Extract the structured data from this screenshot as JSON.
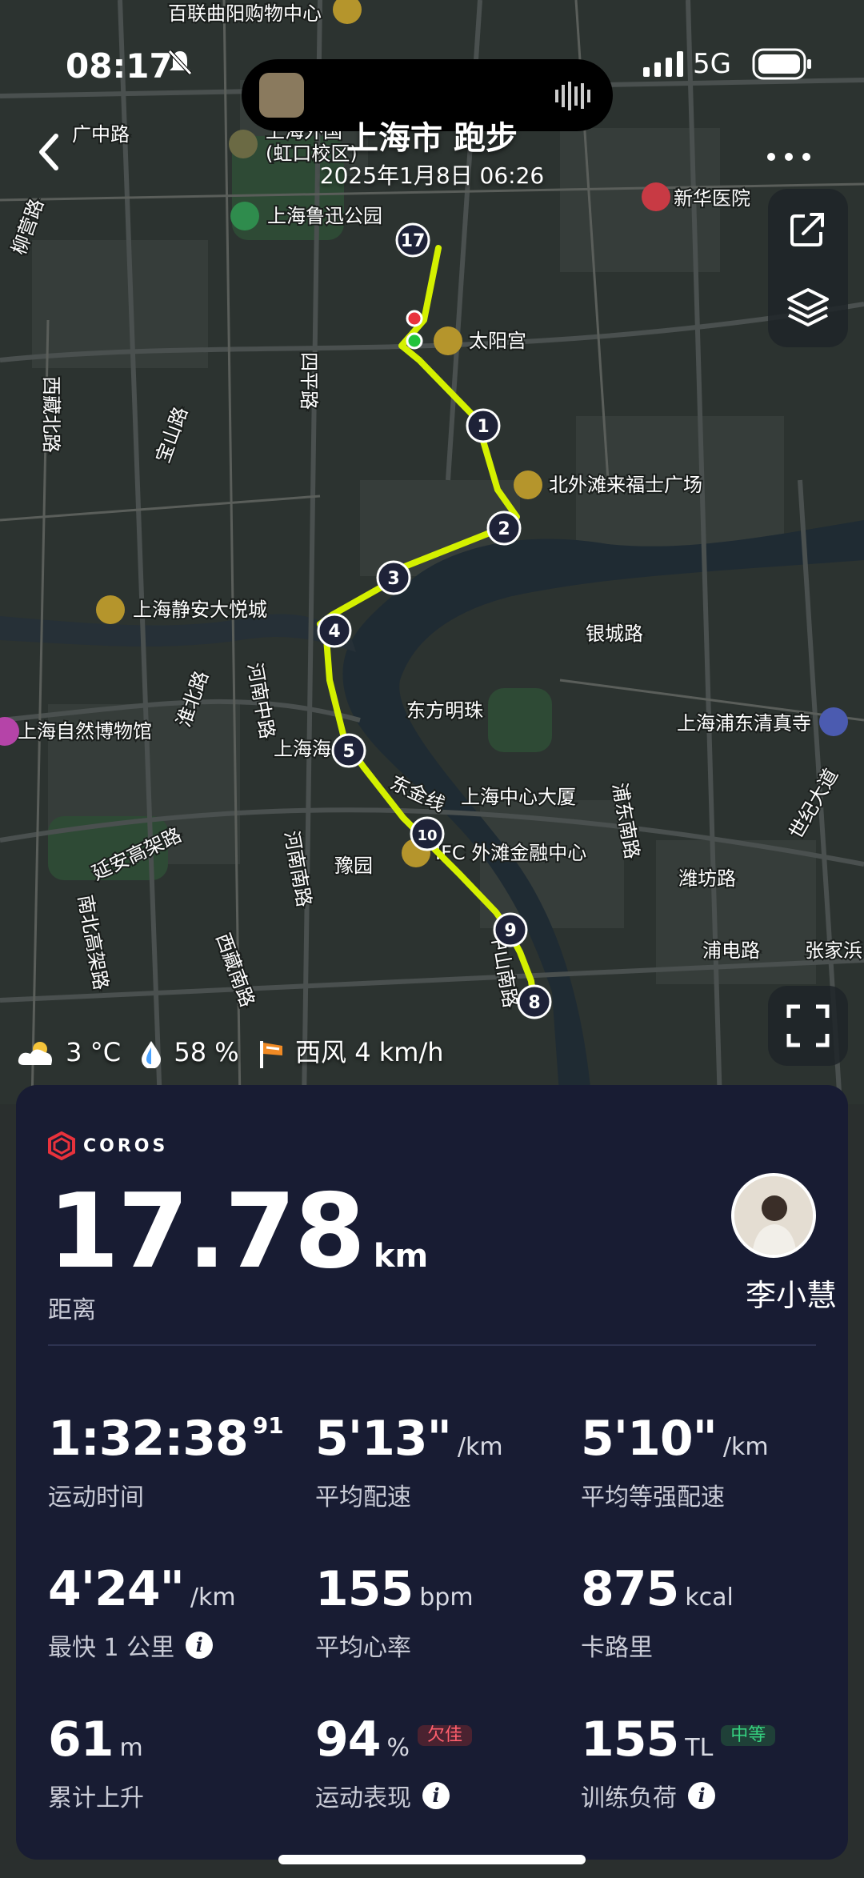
{
  "status_bar": {
    "time": "08:17",
    "network": "5G"
  },
  "header": {
    "title": "上海市 跑步",
    "subtitle": "2025年1月8日 06:26"
  },
  "map_labels": [
    "百联曲阳购物中心",
    "广中路",
    "上海外国",
    "(虹口校区)",
    "上海鲁迅公园",
    "新华医院",
    "柳营路",
    "太阳宫",
    "四平路",
    "西藏北路",
    "宝山路",
    "北外滩来福士广场",
    "上海静安大悦城",
    "河南中路",
    "银城路",
    "东方明珠",
    "上海浦东清真寺",
    "上海自然博物馆",
    "淮北路",
    "上海海",
    "东金线",
    "上海中心大厦",
    "浦东南路",
    "延安高架路",
    "豫园",
    "IFC 外滩金融中心",
    "河南南路",
    "潍坊路",
    "世纪大道",
    "西藏南路",
    "中山南路",
    "浦电路",
    "张家浜",
    "南北高架路"
  ],
  "route_markers": [
    "17",
    "1",
    "2",
    "3",
    "4",
    "5",
    "10",
    "9",
    "8"
  ],
  "weather": {
    "temp": "3 °C",
    "humidity": "58 %",
    "wind": "西风 4 km/h"
  },
  "card": {
    "brand": "COROS",
    "distance": {
      "value": "17.78",
      "unit": "km",
      "label": "距离"
    },
    "user": {
      "name": "李小慧"
    },
    "metrics": [
      {
        "value": "1:32:38",
        "sup": "91",
        "unit": "",
        "label": "运动时间"
      },
      {
        "value": "5'13\"",
        "unit": "/km",
        "label": "平均配速"
      },
      {
        "value": "5'10\"",
        "unit": "/km",
        "label": "平均等强配速"
      },
      {
        "value": "4'24\"",
        "unit": "/km",
        "label": "最快 1 公里"
      },
      {
        "value": "155",
        "unit": "bpm",
        "label": "平均心率"
      },
      {
        "value": "875",
        "unit": "kcal",
        "label": "卡路里"
      },
      {
        "value": "61",
        "unit": "m",
        "label": "累计上升"
      },
      {
        "value": "94",
        "unit": "%",
        "tag": "欠佳",
        "label": "运动表现"
      },
      {
        "value": "155",
        "unit": "TL",
        "tag": "中等",
        "label": "训练负荷"
      }
    ]
  },
  "colors": {
    "route": "#d4f000",
    "card_bg": "#181c33",
    "accent_red": "#e8323c",
    "tag_red": "#ff5f6d",
    "tag_green": "#35d07f"
  }
}
